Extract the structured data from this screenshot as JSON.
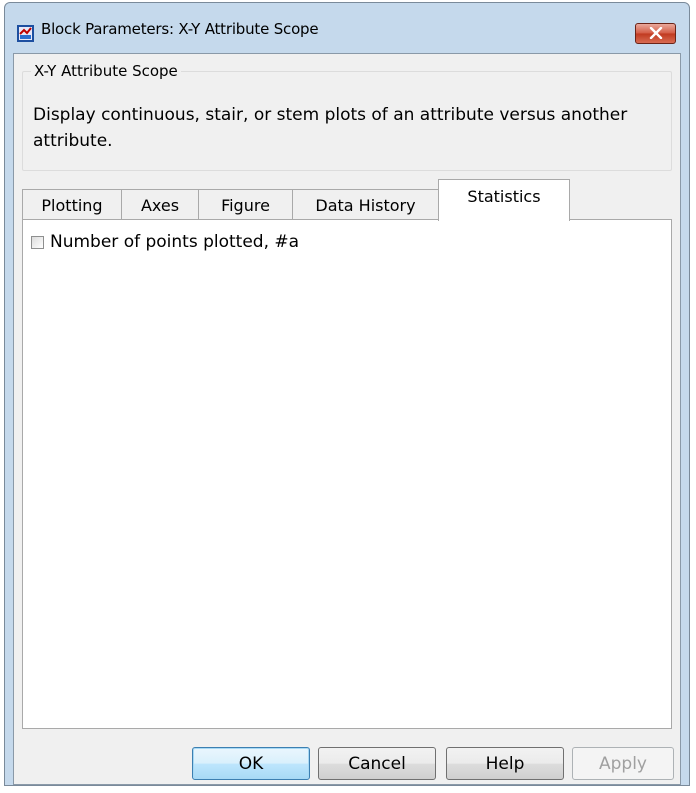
{
  "window": {
    "title": "Block Parameters: X-Y Attribute Scope",
    "close_icon": "close-icon",
    "app_icon": "simulink-block-icon"
  },
  "description": {
    "group_title": "X-Y Attribute Scope",
    "text": "Display continuous, stair, or stem plots of an attribute versus another attribute."
  },
  "tabs": [
    {
      "label": "Plotting",
      "active": false
    },
    {
      "label": "Axes",
      "active": false
    },
    {
      "label": "Figure",
      "active": false
    },
    {
      "label": "Data History",
      "active": false
    },
    {
      "label": "Statistics",
      "active": true
    }
  ],
  "statistics": {
    "checkbox_label": "Number of points plotted, #a",
    "checked": false
  },
  "buttons": {
    "ok": "OK",
    "cancel": "Cancel",
    "help": "Help",
    "apply": "Apply"
  },
  "colors": {
    "title_bar": "#c5d9ec",
    "close_button": "#c7412a",
    "dialog_bg": "#f0f0f0"
  }
}
